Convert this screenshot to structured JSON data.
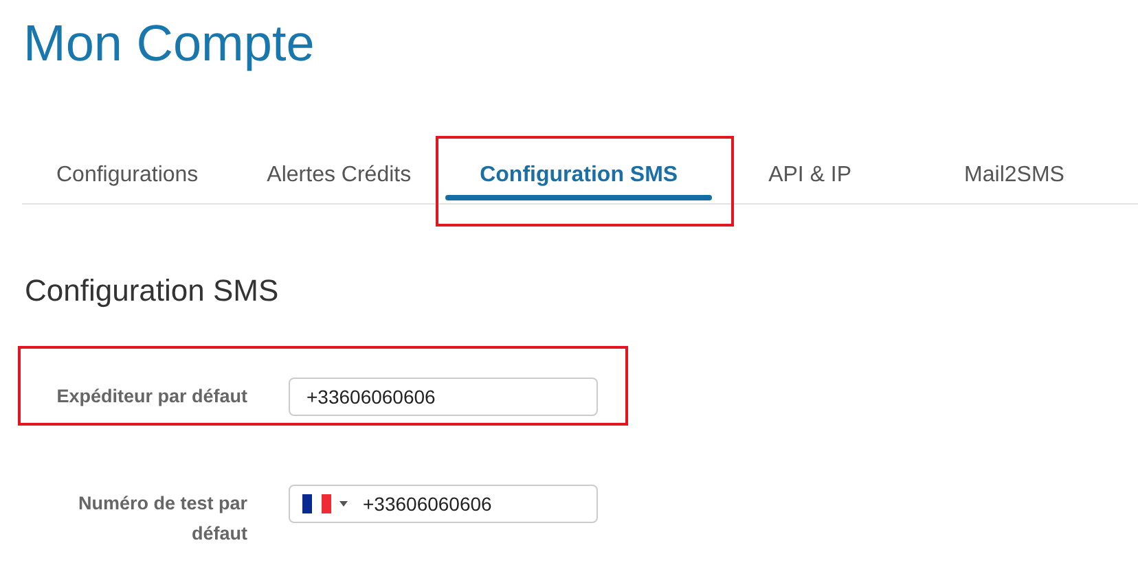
{
  "page": {
    "title": "Mon Compte"
  },
  "tabs": [
    {
      "label": "Configurations",
      "selected": false,
      "highlighted": false
    },
    {
      "label": "Alertes Crédits",
      "selected": false,
      "highlighted": false
    },
    {
      "label": "Configuration SMS",
      "selected": true,
      "highlighted": true
    },
    {
      "label": "API & IP",
      "selected": false,
      "highlighted": false
    },
    {
      "label": "Mail2SMS",
      "selected": false,
      "highlighted": false
    }
  ],
  "section": {
    "title": "Configuration SMS"
  },
  "fields": [
    {
      "kind": "text",
      "label": "Expéditeur par défaut",
      "value": "+33606060606",
      "highlighted": true
    },
    {
      "kind": "phone",
      "label": "Numéro de test par défaut",
      "value": "+33606060606",
      "highlighted": false
    }
  ]
}
